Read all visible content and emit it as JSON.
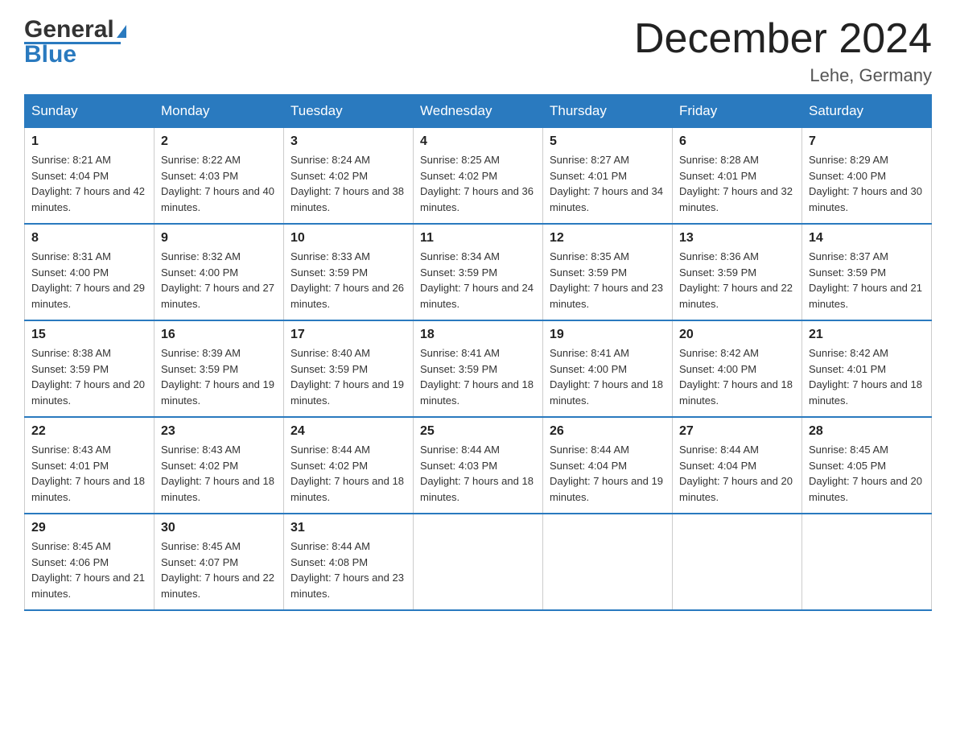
{
  "header": {
    "logo_general": "General",
    "logo_blue": "Blue",
    "month_title": "December 2024",
    "location": "Lehe, Germany"
  },
  "days_of_week": [
    "Sunday",
    "Monday",
    "Tuesday",
    "Wednesday",
    "Thursday",
    "Friday",
    "Saturday"
  ],
  "weeks": [
    [
      {
        "day": "1",
        "sunrise": "8:21 AM",
        "sunset": "4:04 PM",
        "daylight": "7 hours and 42 minutes."
      },
      {
        "day": "2",
        "sunrise": "8:22 AM",
        "sunset": "4:03 PM",
        "daylight": "7 hours and 40 minutes."
      },
      {
        "day": "3",
        "sunrise": "8:24 AM",
        "sunset": "4:02 PM",
        "daylight": "7 hours and 38 minutes."
      },
      {
        "day": "4",
        "sunrise": "8:25 AM",
        "sunset": "4:02 PM",
        "daylight": "7 hours and 36 minutes."
      },
      {
        "day": "5",
        "sunrise": "8:27 AM",
        "sunset": "4:01 PM",
        "daylight": "7 hours and 34 minutes."
      },
      {
        "day": "6",
        "sunrise": "8:28 AM",
        "sunset": "4:01 PM",
        "daylight": "7 hours and 32 minutes."
      },
      {
        "day": "7",
        "sunrise": "8:29 AM",
        "sunset": "4:00 PM",
        "daylight": "7 hours and 30 minutes."
      }
    ],
    [
      {
        "day": "8",
        "sunrise": "8:31 AM",
        "sunset": "4:00 PM",
        "daylight": "7 hours and 29 minutes."
      },
      {
        "day": "9",
        "sunrise": "8:32 AM",
        "sunset": "4:00 PM",
        "daylight": "7 hours and 27 minutes."
      },
      {
        "day": "10",
        "sunrise": "8:33 AM",
        "sunset": "3:59 PM",
        "daylight": "7 hours and 26 minutes."
      },
      {
        "day": "11",
        "sunrise": "8:34 AM",
        "sunset": "3:59 PM",
        "daylight": "7 hours and 24 minutes."
      },
      {
        "day": "12",
        "sunrise": "8:35 AM",
        "sunset": "3:59 PM",
        "daylight": "7 hours and 23 minutes."
      },
      {
        "day": "13",
        "sunrise": "8:36 AM",
        "sunset": "3:59 PM",
        "daylight": "7 hours and 22 minutes."
      },
      {
        "day": "14",
        "sunrise": "8:37 AM",
        "sunset": "3:59 PM",
        "daylight": "7 hours and 21 minutes."
      }
    ],
    [
      {
        "day": "15",
        "sunrise": "8:38 AM",
        "sunset": "3:59 PM",
        "daylight": "7 hours and 20 minutes."
      },
      {
        "day": "16",
        "sunrise": "8:39 AM",
        "sunset": "3:59 PM",
        "daylight": "7 hours and 19 minutes."
      },
      {
        "day": "17",
        "sunrise": "8:40 AM",
        "sunset": "3:59 PM",
        "daylight": "7 hours and 19 minutes."
      },
      {
        "day": "18",
        "sunrise": "8:41 AM",
        "sunset": "3:59 PM",
        "daylight": "7 hours and 18 minutes."
      },
      {
        "day": "19",
        "sunrise": "8:41 AM",
        "sunset": "4:00 PM",
        "daylight": "7 hours and 18 minutes."
      },
      {
        "day": "20",
        "sunrise": "8:42 AM",
        "sunset": "4:00 PM",
        "daylight": "7 hours and 18 minutes."
      },
      {
        "day": "21",
        "sunrise": "8:42 AM",
        "sunset": "4:01 PM",
        "daylight": "7 hours and 18 minutes."
      }
    ],
    [
      {
        "day": "22",
        "sunrise": "8:43 AM",
        "sunset": "4:01 PM",
        "daylight": "7 hours and 18 minutes."
      },
      {
        "day": "23",
        "sunrise": "8:43 AM",
        "sunset": "4:02 PM",
        "daylight": "7 hours and 18 minutes."
      },
      {
        "day": "24",
        "sunrise": "8:44 AM",
        "sunset": "4:02 PM",
        "daylight": "7 hours and 18 minutes."
      },
      {
        "day": "25",
        "sunrise": "8:44 AM",
        "sunset": "4:03 PM",
        "daylight": "7 hours and 18 minutes."
      },
      {
        "day": "26",
        "sunrise": "8:44 AM",
        "sunset": "4:04 PM",
        "daylight": "7 hours and 19 minutes."
      },
      {
        "day": "27",
        "sunrise": "8:44 AM",
        "sunset": "4:04 PM",
        "daylight": "7 hours and 20 minutes."
      },
      {
        "day": "28",
        "sunrise": "8:45 AM",
        "sunset": "4:05 PM",
        "daylight": "7 hours and 20 minutes."
      }
    ],
    [
      {
        "day": "29",
        "sunrise": "8:45 AM",
        "sunset": "4:06 PM",
        "daylight": "7 hours and 21 minutes."
      },
      {
        "day": "30",
        "sunrise": "8:45 AM",
        "sunset": "4:07 PM",
        "daylight": "7 hours and 22 minutes."
      },
      {
        "day": "31",
        "sunrise": "8:44 AM",
        "sunset": "4:08 PM",
        "daylight": "7 hours and 23 minutes."
      },
      null,
      null,
      null,
      null
    ]
  ]
}
